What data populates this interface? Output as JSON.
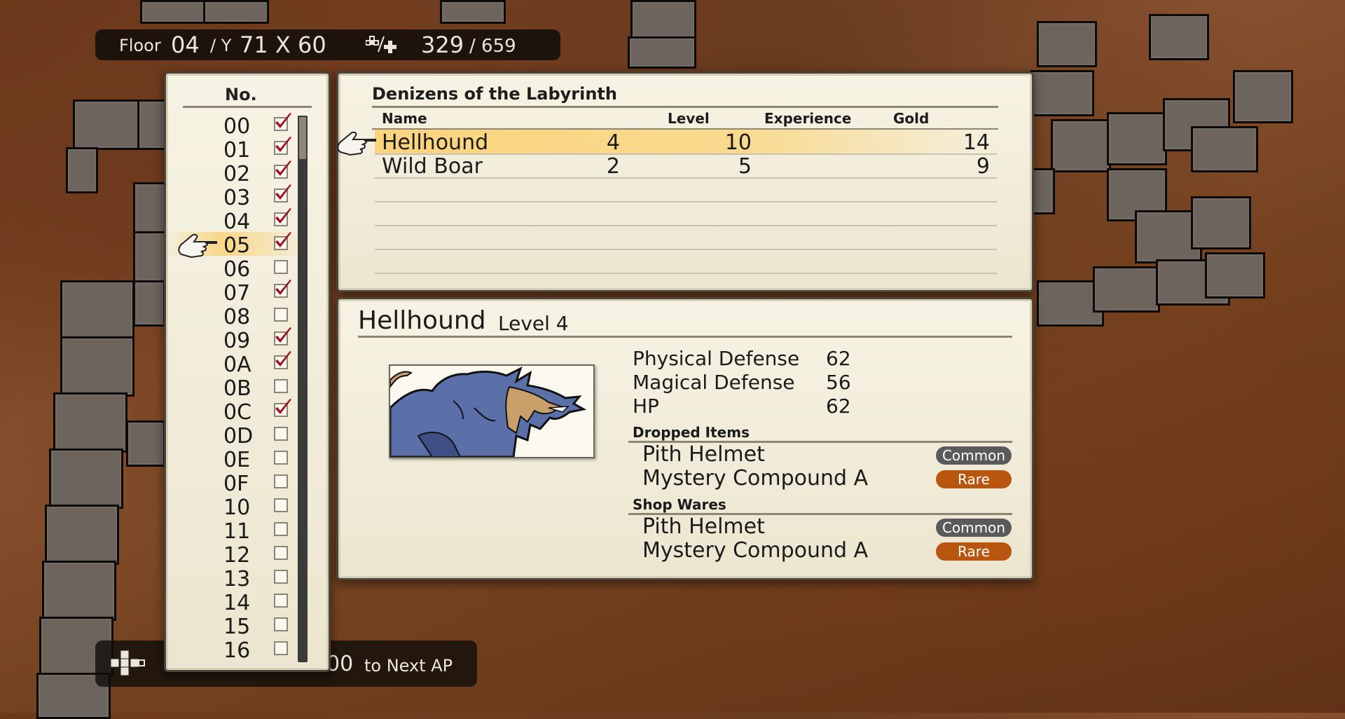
{
  "status": {
    "floor_label": "Floor",
    "floor_value": "04",
    "y_label": "/ Y",
    "coords": "71 X 60",
    "steps_current": "329",
    "steps_max": "/ 659"
  },
  "footer": {
    "ap_value": "00",
    "ap_label": "to Next AP"
  },
  "floor_list": {
    "header": "No.",
    "selected_index": 5,
    "items": [
      {
        "num": "00",
        "checked": true
      },
      {
        "num": "01",
        "checked": true
      },
      {
        "num": "02",
        "checked": true
      },
      {
        "num": "03",
        "checked": true
      },
      {
        "num": "04",
        "checked": true
      },
      {
        "num": "05",
        "checked": true
      },
      {
        "num": "06",
        "checked": false
      },
      {
        "num": "07",
        "checked": true
      },
      {
        "num": "08",
        "checked": false
      },
      {
        "num": "09",
        "checked": true
      },
      {
        "num": "0A",
        "checked": true
      },
      {
        "num": "0B",
        "checked": false
      },
      {
        "num": "0C",
        "checked": true
      },
      {
        "num": "0D",
        "checked": false
      },
      {
        "num": "0E",
        "checked": false
      },
      {
        "num": "0F",
        "checked": false
      },
      {
        "num": "10",
        "checked": false
      },
      {
        "num": "11",
        "checked": false
      },
      {
        "num": "12",
        "checked": false
      },
      {
        "num": "13",
        "checked": false
      },
      {
        "num": "14",
        "checked": false
      },
      {
        "num": "15",
        "checked": false
      },
      {
        "num": "16",
        "checked": false
      }
    ]
  },
  "denizens": {
    "title": "Denizens of the Labyrinth",
    "columns": {
      "name": "Name",
      "level": "Level",
      "experience": "Experience",
      "gold": "Gold"
    },
    "rows": [
      {
        "name": "Hellhound",
        "level": "4",
        "experience": "10",
        "gold": "14"
      },
      {
        "name": "Wild Boar",
        "level": "2",
        "experience": "5",
        "gold": "9"
      }
    ]
  },
  "detail": {
    "name": "Hellhound",
    "level": "Level 4",
    "portrait": "hellhound-portrait",
    "stats": [
      {
        "label": "Physical Defense",
        "value": "62"
      },
      {
        "label": "Magical Defense",
        "value": "56"
      },
      {
        "label": "HP",
        "value": "62"
      }
    ],
    "dropped_title": "Dropped Items",
    "dropped": [
      {
        "name": "Pith Helmet",
        "rarity": "Common"
      },
      {
        "name": "Mystery Compound A",
        "rarity": "Rare"
      }
    ],
    "shop_title": "Shop Wares",
    "shop": [
      {
        "name": "Pith Helmet",
        "rarity": "Common"
      },
      {
        "name": "Mystery Compound A",
        "rarity": "Rare"
      }
    ]
  },
  "colors": {
    "common_badge": "#5a5a5a",
    "rare_badge": "#b8560f",
    "check_mark": "#a01020",
    "selection_highlight": "#f5cf7a"
  }
}
